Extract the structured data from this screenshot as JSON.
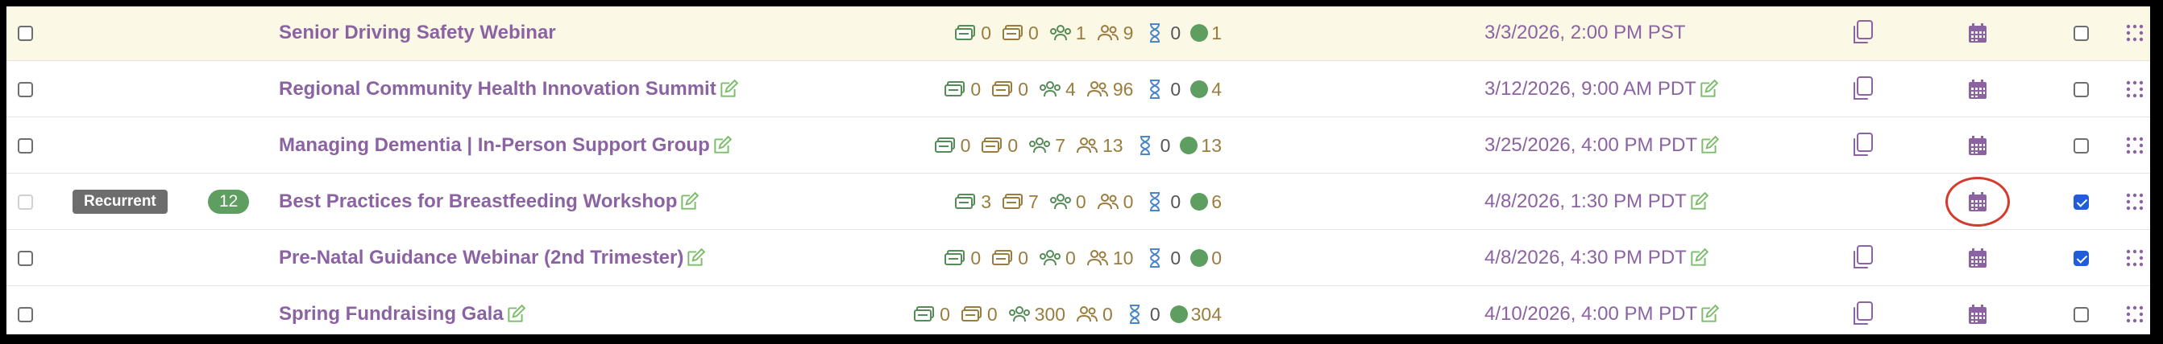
{
  "rows": [
    {
      "title": "Senior Driving Safety Webinar",
      "counts": [
        "0",
        "0",
        "1",
        "9",
        "0",
        "1"
      ],
      "date": "3/3/2026, 2:00 PM PST",
      "recurrent": "",
      "occurrences": "",
      "checked": false,
      "editable": false,
      "highlight": true
    },
    {
      "title": "Regional Community Health Innovation Summit",
      "counts": [
        "0",
        "0",
        "4",
        "96",
        "0",
        "4"
      ],
      "date": "3/12/2026, 9:00 AM PDT",
      "recurrent": "",
      "occurrences": "",
      "checked": false,
      "editable": true,
      "highlight": false
    },
    {
      "title": "Managing Dementia | In-Person Support Group",
      "counts": [
        "0",
        "0",
        "7",
        "13",
        "0",
        "13"
      ],
      "date": "3/25/2026, 4:00 PM PDT",
      "recurrent": "",
      "occurrences": "",
      "checked": false,
      "editable": true,
      "highlight": false
    },
    {
      "title": "Best Practices for Breastfeeding Workshop",
      "counts": [
        "3",
        "7",
        "0",
        "0",
        "0",
        "6"
      ],
      "date": "4/8/2026, 1:30 PM PDT",
      "recurrent": "Recurrent",
      "occurrences": "12",
      "checked": true,
      "editable": true,
      "highlight": false
    },
    {
      "title": "Pre-Natal Guidance Webinar (2nd Trimester)",
      "counts": [
        "0",
        "0",
        "0",
        "10",
        "0",
        "0"
      ],
      "date": "4/8/2026, 4:30 PM PDT",
      "recurrent": "",
      "occurrences": "",
      "checked": true,
      "editable": true,
      "highlight": false
    },
    {
      "title": "Spring Fundraising Gala",
      "counts": [
        "0",
        "0",
        "300",
        "0",
        "0",
        "304"
      ],
      "date": "4/10/2026, 4:00 PM PDT",
      "recurrent": "",
      "occurrences": "",
      "checked": false,
      "editable": true,
      "highlight": false
    }
  ],
  "icons": {
    "count_icons": [
      "tickets-icon",
      "tickets-alt-icon",
      "attendees-icon",
      "registrants-icon",
      "hourglass-icon",
      "status-dot-icon"
    ],
    "edit": "edit-icon",
    "copy": "copy-icon",
    "calendar": "calendar-icon",
    "drag": "drag-handle-icon"
  },
  "colors": {
    "title": "#8c63a2",
    "count_tan": "#9a7d3e",
    "count_green": "#558b57",
    "badge_recurrent": "#6d6d6d",
    "badge_count": "#5e9e60",
    "highlight_row": "#fcf8e6",
    "annotation_circle": "#d63a2c"
  }
}
